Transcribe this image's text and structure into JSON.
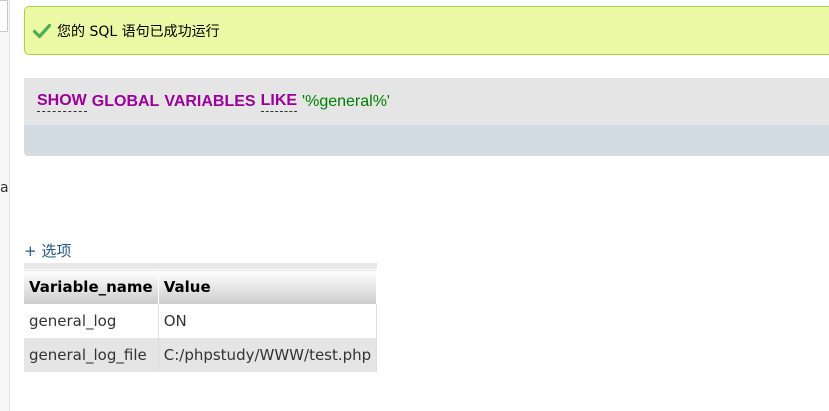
{
  "left_edge": {
    "letter": "a"
  },
  "success_message": {
    "icon": "check-icon",
    "text": "您的 SQL 语句已成功运行",
    "colors": {
      "background": "#ebf8a4",
      "border": "#a2d246",
      "check": "#4caf50"
    }
  },
  "sql": {
    "keywords": [
      "SHOW",
      "GLOBAL",
      "VARIABLES",
      "LIKE"
    ],
    "string": "'%general%'",
    "colors": {
      "keyword": "#990099",
      "string": "#008000"
    }
  },
  "options_link": "+ 选项",
  "result_table": {
    "headers": [
      "Variable_name",
      "Value"
    ],
    "rows": [
      {
        "variable": "general_log",
        "value": "ON"
      },
      {
        "variable": "general_log_file",
        "value": "C:/phpstudy/WWW/test.php"
      }
    ]
  }
}
